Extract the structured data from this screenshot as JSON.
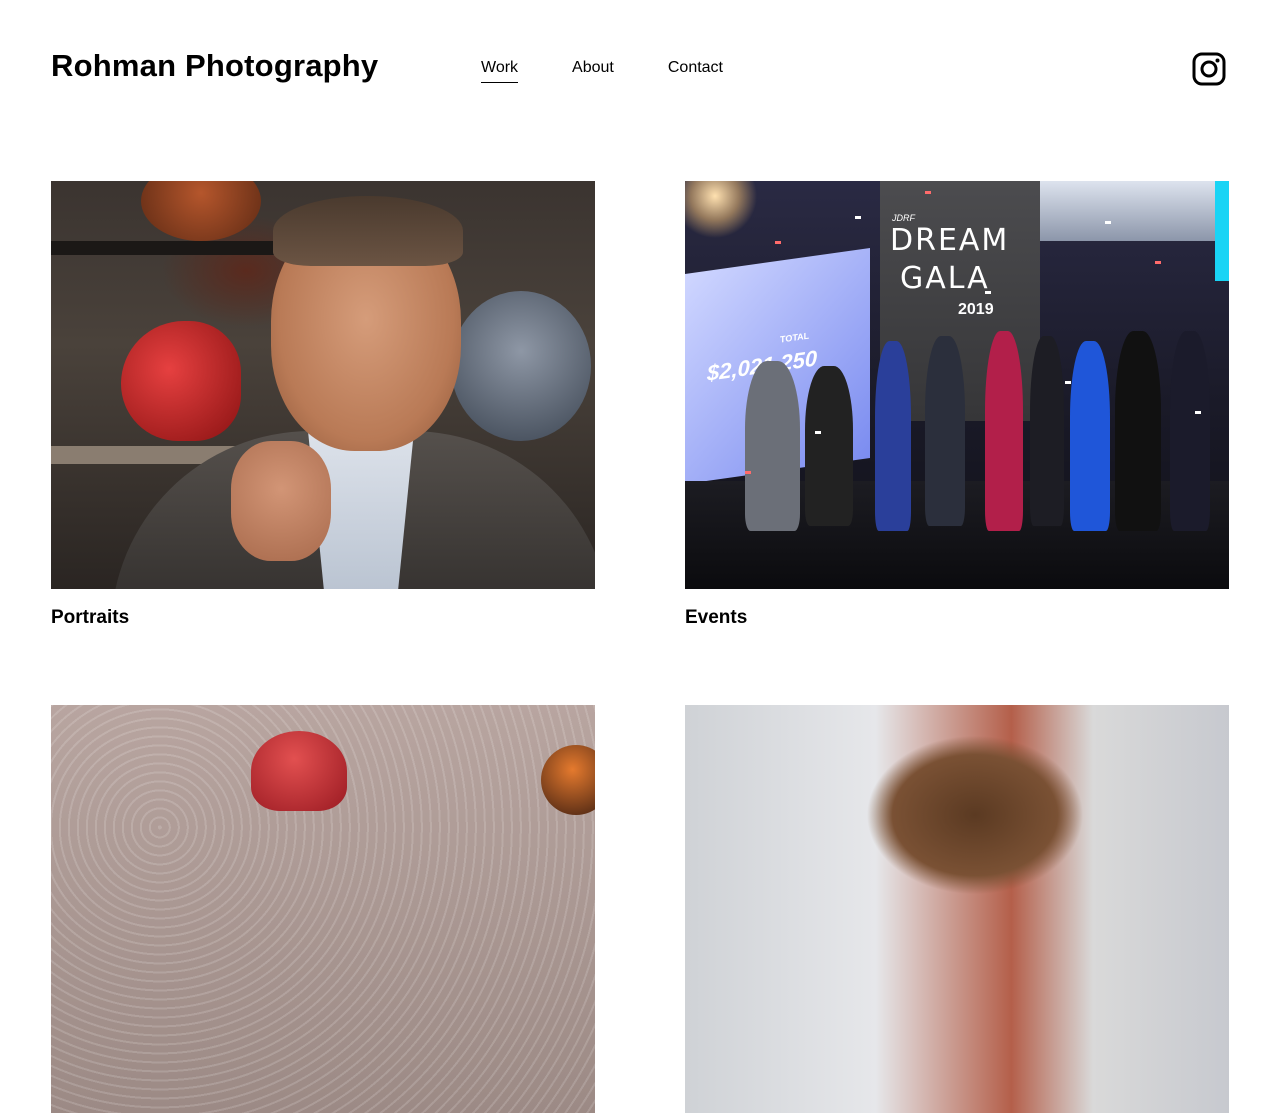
{
  "site": {
    "title": "Rohman Photography"
  },
  "nav": {
    "items": [
      {
        "label": "Work",
        "active": true
      },
      {
        "label": "About",
        "active": false
      },
      {
        "label": "Contact",
        "active": false
      }
    ],
    "social_icon": "instagram-icon"
  },
  "gallery": {
    "tiles": [
      {
        "label": "Portraits"
      },
      {
        "label": "Events",
        "photo_text": {
          "total_small": "TOTAL",
          "amount": "$2,021,250",
          "org": "JDRF",
          "line1": "DREAM",
          "line2": "GALA",
          "year": "2019"
        }
      },
      {
        "label": ""
      },
      {
        "label": ""
      }
    ]
  }
}
